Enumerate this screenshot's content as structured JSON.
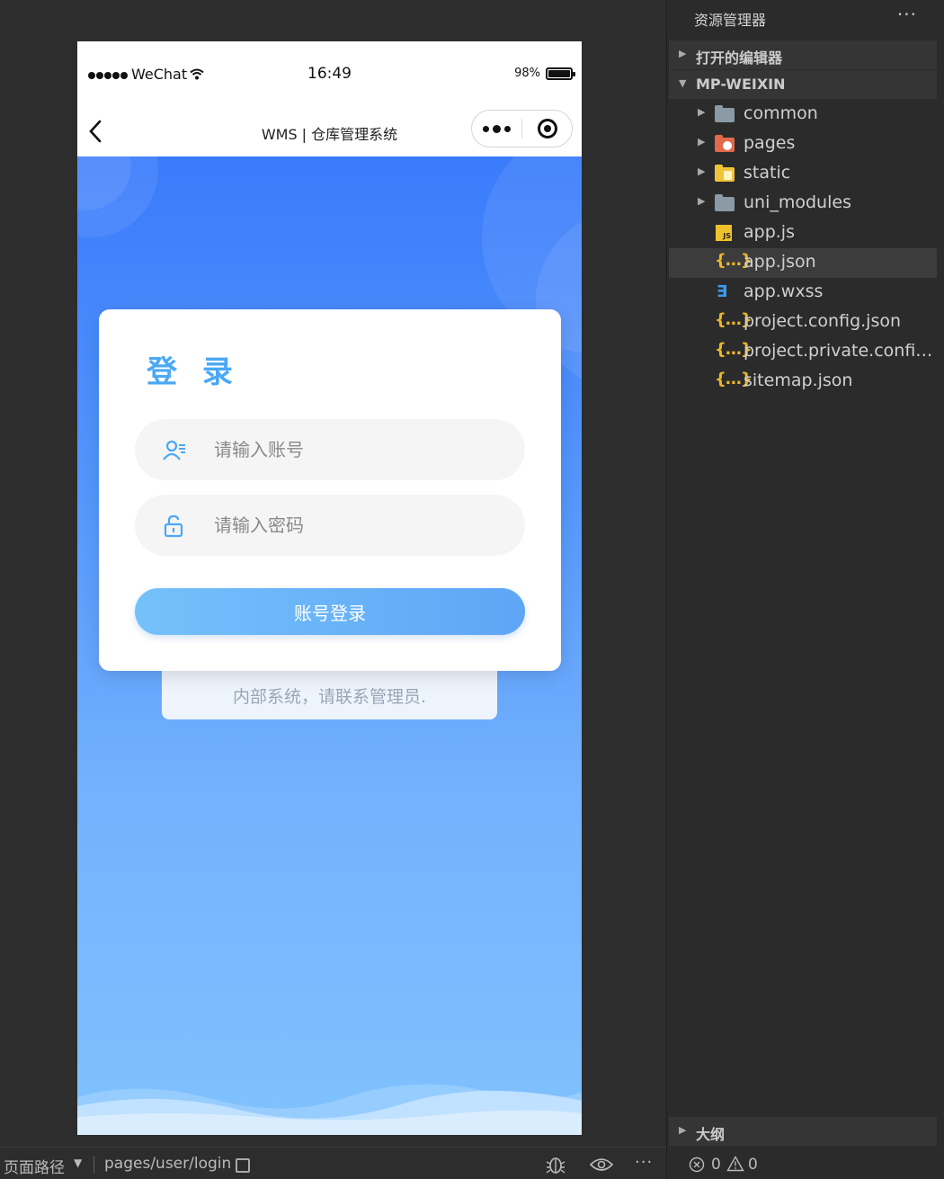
{
  "simulator": {
    "status_bar": {
      "carrier": "WeChat",
      "time": "16:49",
      "battery": "98%",
      "battery_level": 0.98
    },
    "nav_bar": {
      "title": "WMS | 仓库管理系统"
    },
    "login": {
      "heading": "登 录",
      "username_placeholder": "请输入账号",
      "password_placeholder": "请输入密码",
      "submit_label": "账号登录",
      "note": "内部系统，请联系管理员."
    },
    "colors": {
      "accent": "#4ba8f5",
      "gradient_top": "#3a7bfb",
      "gradient_bottom": "#80c1fe"
    }
  },
  "bottom_bar": {
    "path_label": "页面路径",
    "path_value": "pages/user/login",
    "more": "···"
  },
  "explorer": {
    "title": "资源管理器",
    "more": "···",
    "open_editors": "打开的编辑器",
    "project": "MP-WEIXIN",
    "items": [
      {
        "name": "common",
        "icon": "folder-icon"
      },
      {
        "name": "pages",
        "icon": "folder-pages-icon"
      },
      {
        "name": "static",
        "icon": "folder-static-icon"
      },
      {
        "name": "uni_modules",
        "icon": "folder-icon"
      },
      {
        "name": "app.js",
        "icon": "js-file-icon"
      },
      {
        "name": "app.json",
        "icon": "json-file-icon",
        "selected": true
      },
      {
        "name": "app.wxss",
        "icon": "css-file-icon"
      },
      {
        "name": "project.config.json",
        "icon": "json-file-icon"
      },
      {
        "name": "project.private.config.js...",
        "icon": "json-file-icon"
      },
      {
        "name": "sitemap.json",
        "icon": "json-file-icon"
      }
    ],
    "outline": "大纲",
    "problems": {
      "errors": "0",
      "warnings": "0"
    }
  }
}
